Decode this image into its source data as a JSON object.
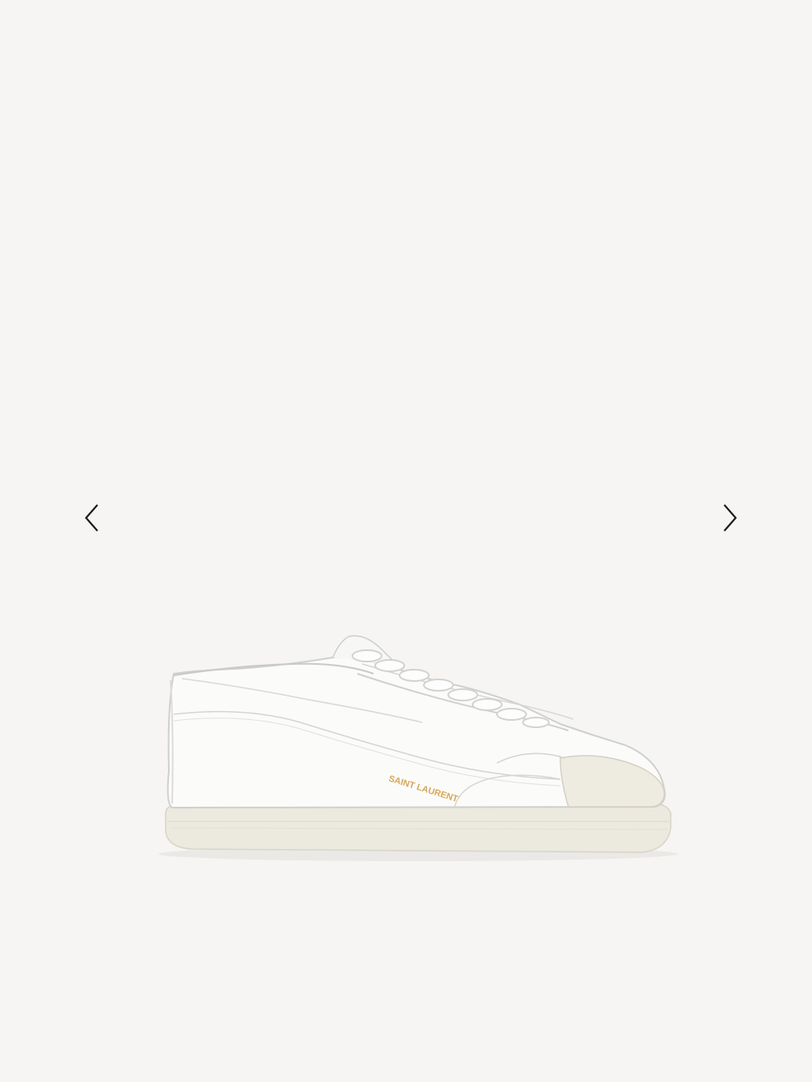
{
  "gallery": {
    "prev_icon": "chevron-left-icon",
    "next_icon": "chevron-right-icon",
    "product_logo_text": "SAINT LAURENT",
    "colors": {
      "background": "#f6f5f3",
      "arrow": "#1a1a1a",
      "logo": "#d6a85a"
    }
  }
}
